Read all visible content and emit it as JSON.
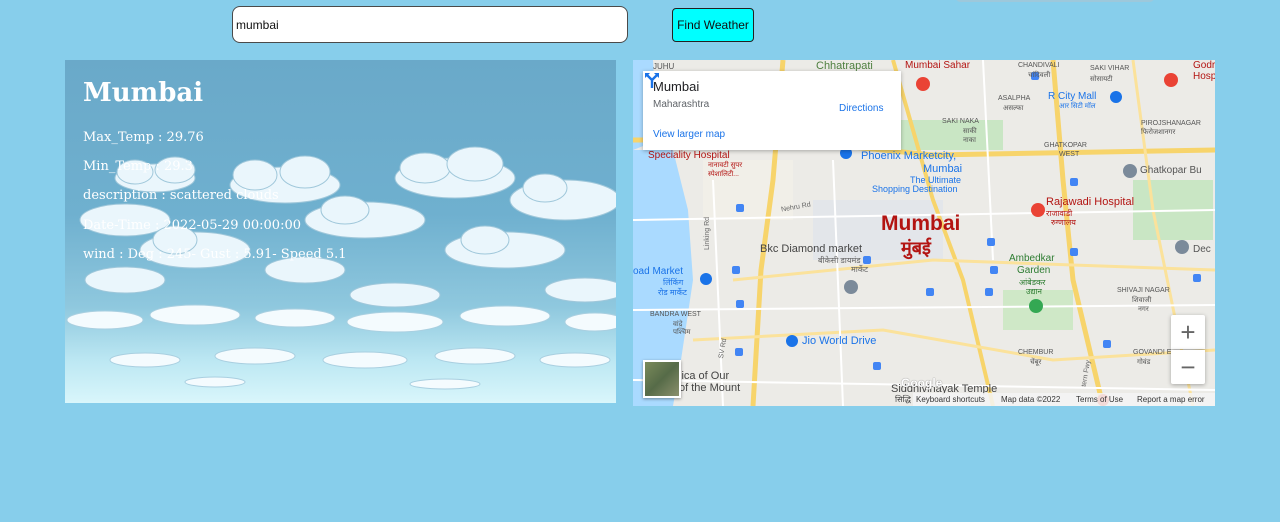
{
  "search": {
    "value": "mumbai",
    "placeholder": ""
  },
  "find_button": {
    "label": "Find Weather"
  },
  "weather": {
    "city": "Mumbai",
    "max_temp": "Max_Temp : 29.76",
    "min_temp": "Min_Temp : 29.3",
    "description": "description : scattered clouds",
    "datetime": "Date-Time : 2022-05-29 00:00:00",
    "wind": "wind : Deg : 245- Gust : 5.91- Speed 5.1"
  },
  "map": {
    "card": {
      "place": "Mumbai",
      "region": "Maharashtra",
      "directions": "Directions",
      "larger_map": "View larger map"
    },
    "labels": {
      "city": "Mumbai",
      "city_local": "मुंबई",
      "chhatrapati": "Chhatrapati",
      "mumbai_sahar": "Mumbai Sahar",
      "juhu": "JUHU",
      "chandivali": "CHANDIVALI",
      "chandivali_local": "चांदिवली",
      "saki_vihar": "SAKI VIHAR",
      "saki_vihar_local": "सोसायटी",
      "godrej": "Godre",
      "godrej_sub": "Hospi",
      "asalpha": "ASALPHA",
      "asalpha_local": "असल्फा",
      "rcity": "R City Mall",
      "rcity_local": "आर सिटी मॉल",
      "saki_naka": "SAKI NAKA",
      "saki_naka_local": "साकी",
      "saki_naka_local2": "नाका",
      "pirojshanagar": "PIROJSHANAGAR",
      "pirojshanagar_local": "फिरोजशानगर",
      "ghatkopar_west": "GHATKOPAR",
      "ghatkopar_west2": "WEST",
      "ghatkopar_bus": "Ghatkopar Bu",
      "speciality": "Speciality Hospital",
      "speciality_local": "नानावटी सुपर",
      "speciality_local2": "स्पेशालिटी...",
      "phoenix": "Phoenix Marketcity,",
      "phoenix2": "Mumbai",
      "phoenix3": "The Ultimate",
      "phoenix4": "Shopping Destination",
      "rajawadi": "Rajawadi Hospital",
      "rajawadi_local": "राजावाडी",
      "rajawadi_local2": "रुग्णालय",
      "nehru": "Nehru Rd",
      "linking": "Linking Rd",
      "bkc": "Bkc Diamond market",
      "bkc_local": "बीकेसी डायमंड",
      "bkc_local2": "मार्केट",
      "dec": "Dec",
      "road_market": "oad Market",
      "road_market_local": "लिंकिंग",
      "road_market_local2": "रोड मार्केट",
      "ambedkar": "Ambedkar",
      "ambedkar2": "Garden",
      "ambedkar_local": "आंबेडकर",
      "ambedkar_local2": "उद्यान",
      "shivaji": "SHIVAJI NAGAR",
      "shivaji_local": "शिवाजी",
      "shivaji_local2": "नगर",
      "bandra": "BANDRA WEST",
      "bandra_local": "वांद्रे",
      "bandra_local2": "पश्चिम",
      "jio": "Jio World Drive",
      "chembur": "CHEMBUR",
      "chembur_local": "चेंबूर",
      "govandi": "GOVANDI E",
      "govandi_local": "गोवंड",
      "mount": "lica of Our",
      "mount2": "of the Mount",
      "siddhivinayak": "Siddhivinayak Temple",
      "siddhivinayak_local": "सिद्धि",
      "sv_rd": "SV Rd",
      "eastern_fwy": "tern Fwy"
    },
    "footer": {
      "logo": "Google",
      "shortcuts": "Keyboard shortcuts",
      "data": "Map data ©2022",
      "terms": "Terms of Use",
      "report": "Report a map error"
    },
    "zoom_in": "+",
    "zoom_out": "−"
  },
  "colors": {
    "page_bg": "#87ceeb",
    "button_bg": "#00ffff",
    "map_label_red": "#b31412",
    "map_link_blue": "#1a73e8"
  }
}
